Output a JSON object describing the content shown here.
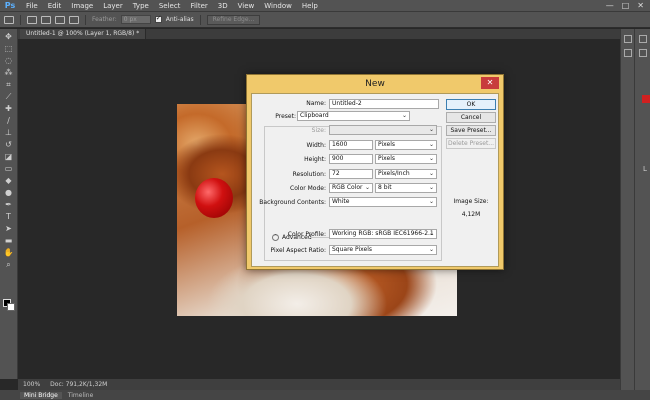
{
  "app": {
    "logo": "Ps"
  },
  "menu": [
    "File",
    "Edit",
    "Image",
    "Layer",
    "Type",
    "Select",
    "Filter",
    "3D",
    "View",
    "Window",
    "Help"
  ],
  "window_controls": [
    "—",
    "□",
    "✕"
  ],
  "options": {
    "feather_label": "Feather:",
    "feather_value": "0 px",
    "anti_alias_label": "Anti-alias",
    "refine_edge_label": "Refine Edge..."
  },
  "document_tab": "Untitled-1 @ 100% (Layer 1, RGB/8) *",
  "status": {
    "zoom": "100%",
    "doc": "Doc: 791,2K/1,32M"
  },
  "bottom_tabs": [
    "Mini Bridge",
    "Timeline"
  ],
  "panel_letter": "L",
  "dialog": {
    "title": "New",
    "close_label": "✕",
    "name_label": "Name:",
    "name_value": "Untitled-2",
    "preset_label": "Preset:",
    "preset_value": "Clipboard",
    "size_label": "Size:",
    "width_label": "Width:",
    "width_value": "1600",
    "width_unit": "Pixels",
    "height_label": "Height:",
    "height_value": "900",
    "height_unit": "Pixels",
    "resolution_label": "Resolution:",
    "resolution_value": "72",
    "resolution_unit": "Pixels/Inch",
    "color_mode_label": "Color Mode:",
    "color_mode_value": "RGB Color",
    "bit_depth_value": "8 bit",
    "background_label": "Background Contents:",
    "background_value": "White",
    "advanced_label": "Advanced",
    "color_profile_label": "Color Profile:",
    "color_profile_value": "Working RGB:  sRGB IEC61966-2.1",
    "pixel_aspect_label": "Pixel Aspect Ratio:",
    "pixel_aspect_value": "Square Pixels",
    "ok_label": "OK",
    "cancel_label": "Cancel",
    "save_preset_label": "Save Preset...",
    "delete_preset_label": "Delete Preset...",
    "image_size_label": "Image Size:",
    "image_size_value": "4,12M"
  },
  "colors": {
    "foreground": "#000000",
    "background": "#ffffff",
    "dialog_frame": "#f0c96b",
    "close_button": "#c83c3c"
  },
  "tools": [
    "move-icon",
    "marquee-icon",
    "lasso-icon",
    "magic-wand-icon",
    "crop-icon",
    "eyedropper-icon",
    "healing-icon",
    "brush-icon",
    "stamp-icon",
    "history-brush-icon",
    "eraser-icon",
    "gradient-icon",
    "blur-icon",
    "dodge-icon",
    "pen-icon",
    "type-icon",
    "path-select-icon",
    "shape-icon",
    "hand-icon",
    "zoom-icon"
  ]
}
